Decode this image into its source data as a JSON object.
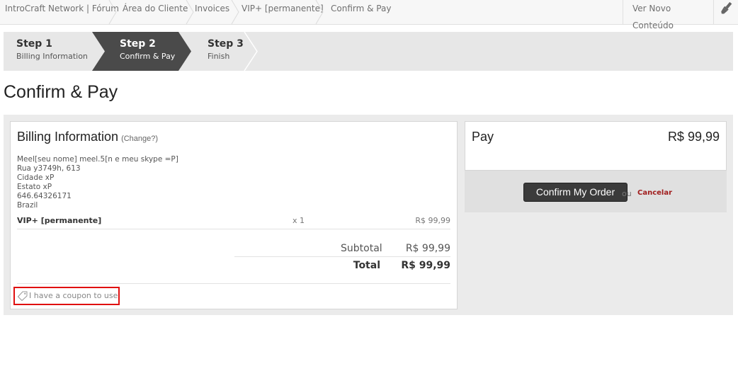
{
  "breadcrumb": [
    "IntroCraft Network | Fórum",
    "Área do Cliente",
    "Invoices",
    "VIP+ [permanente]",
    "Confirm & Pay"
  ],
  "topbar": {
    "new_content": "Ver Novo Conteúdo",
    "brush_icon": "paintbrush-icon"
  },
  "steps": [
    {
      "title": "Step 1",
      "subtitle": "Billing Information"
    },
    {
      "title": "Step 2",
      "subtitle": "Confirm & Pay"
    },
    {
      "title": "Step 3",
      "subtitle": "Finish"
    }
  ],
  "page_title": "Confirm & Pay",
  "billing": {
    "heading": "Billing Information",
    "change": "(Change?)",
    "address": [
      "Meel[seu nome] meel.5[n e meu skype =P]",
      "Rua y3749h, 613",
      "Cidade xP",
      "Estato xP",
      "646.64326171",
      "Brazil"
    ]
  },
  "item": {
    "name": "VIP+ [permanente]",
    "qty": "x 1",
    "price": "R$ 99,99"
  },
  "totals": {
    "subtotal_label": "Subtotal",
    "subtotal_value": "R$ 99,99",
    "total_label": "Total",
    "total_value": "R$ 99,99"
  },
  "coupon": {
    "label": "I have a coupon to use",
    "icon": "tag-icon"
  },
  "pay": {
    "label": "Pay",
    "amount": "R$ 99,99",
    "confirm_button": "Confirm My Order",
    "or": "ou",
    "cancel": "Cancelar"
  },
  "colors": {
    "active_step": "#4a4a4a",
    "highlight": "#e01010",
    "cancel": "#a01c1c"
  }
}
